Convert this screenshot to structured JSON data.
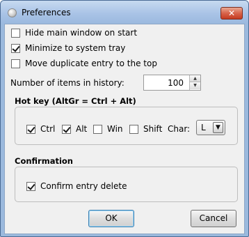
{
  "window": {
    "title": "Preferences",
    "close_glyph": "✕"
  },
  "general": {
    "hide_main_window": {
      "label": "Hide main window on start",
      "checked": false
    },
    "minimize_to_tray": {
      "label": "Minimize to system tray",
      "checked": true
    },
    "move_duplicate": {
      "label": "Move duplicate entry to the top",
      "checked": false
    }
  },
  "history": {
    "label": "Number of items in history:",
    "value": "100"
  },
  "hotkey": {
    "title": "Hot key (AltGr = Ctrl + Alt)",
    "ctrl": {
      "label": "Ctrl",
      "checked": true
    },
    "alt": {
      "label": "Alt",
      "checked": true
    },
    "win": {
      "label": "Win",
      "checked": false
    },
    "shift": {
      "label": "Shift",
      "checked": false
    },
    "char_label": "Char:",
    "char_value": "L"
  },
  "confirmation": {
    "title": "Confirmation",
    "confirm_delete": {
      "label": "Confirm entry delete",
      "checked": true
    }
  },
  "buttons": {
    "ok": "OK",
    "cancel": "Cancel"
  }
}
